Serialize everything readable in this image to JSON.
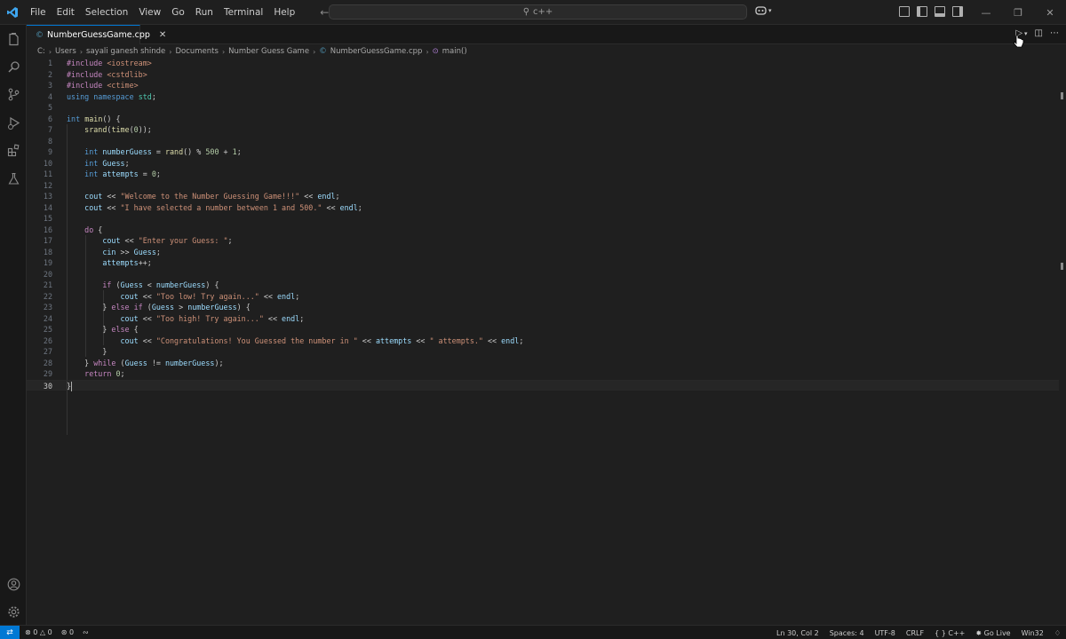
{
  "titlebar": {
    "menu": [
      "File",
      "Edit",
      "Selection",
      "View",
      "Go",
      "Run",
      "Terminal",
      "Help"
    ],
    "search_text": "c++"
  },
  "tab": {
    "filename": "NumberGuessGame.cpp"
  },
  "breadcrumb": [
    "C:",
    "Users",
    "sayali ganesh shinde",
    "Documents",
    "Number Guess Game",
    "NumberGuessGame.cpp",
    "main()"
  ],
  "code_lines": [
    "#include <iostream>",
    "#include <cstdlib>",
    "#include <ctime>",
    "using namespace std;",
    "",
    "int main() {",
    "    srand(time(0));",
    "",
    "    int numberGuess = rand() % 500 + 1;",
    "    int Guess;",
    "    int attempts = 0;",
    "",
    "    cout << \"Welcome to the Number Guessing Game!!!\" << endl;",
    "    cout << \"I have selected a number between 1 and 500.\" << endl;",
    "",
    "    do {",
    "        cout << \"Enter your Guess: \";",
    "        cin >> Guess;",
    "        attempts++;",
    "",
    "        if (Guess < numberGuess) {",
    "            cout << \"Too low! Try again...\" << endl;",
    "        } else if (Guess > numberGuess) {",
    "            cout << \"Too high! Try again...\" << endl;",
    "        } else {",
    "            cout << \"Congratulations! You Guessed the number in \" << attempts << \" attempts.\" << endl;",
    "        }",
    "    } while (Guess != numberGuess);",
    "    return 0;",
    "}"
  ],
  "active_line": 30,
  "statusbar": {
    "errors": "0",
    "warnings": "0",
    "ports": "0",
    "position": "Ln 30, Col 2",
    "spaces": "Spaces: 4",
    "encoding": "UTF-8",
    "eol": "CRLF",
    "language": "C++",
    "golive": "Go Live",
    "platform": "Win32"
  }
}
